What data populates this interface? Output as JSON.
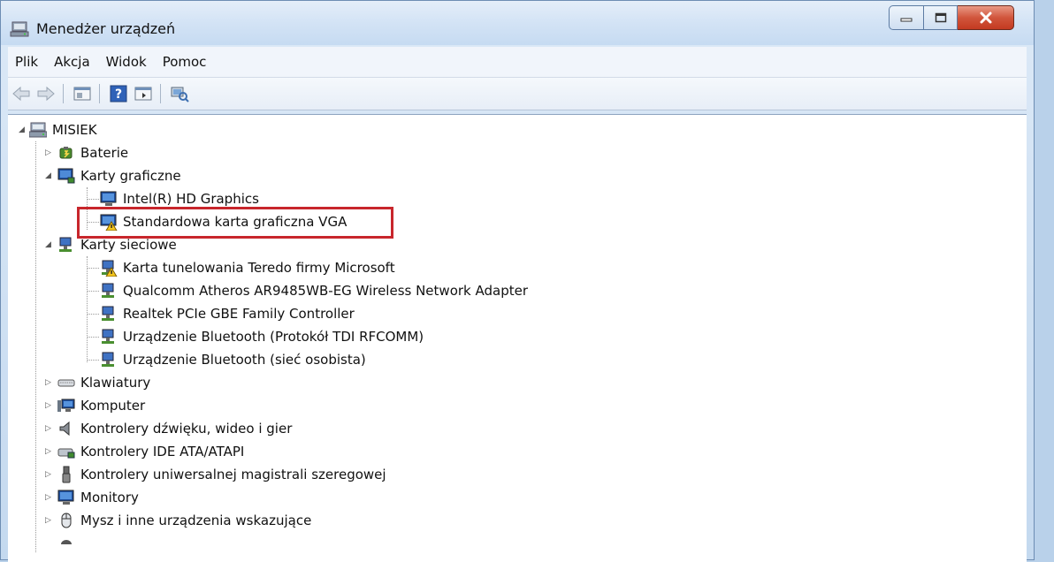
{
  "window": {
    "title": "Menedżer urządzeń"
  },
  "menu": [
    "Plik",
    "Akcja",
    "Widok",
    "Pomoc"
  ],
  "toolbar": {
    "buttons": [
      "back-icon",
      "forward-icon",
      "properties-icon",
      "help-icon",
      "show-hide-icon",
      "scan-hardware-icon"
    ]
  },
  "tree": {
    "root": "MISIEK",
    "categories": [
      {
        "label": "Baterie",
        "expanded": false,
        "icon": "battery-icon"
      },
      {
        "label": "Karty graficzne",
        "expanded": true,
        "icon": "display-adapter-icon",
        "children": [
          {
            "label": "Intel(R) HD Graphics",
            "icon": "monitor-icon",
            "warning": false
          },
          {
            "label": "Standardowa karta graficzna VGA",
            "icon": "monitor-icon",
            "warning": true
          }
        ]
      },
      {
        "label": "Karty sieciowe",
        "expanded": true,
        "icon": "network-adapter-icon",
        "children": [
          {
            "label": "Karta tunelowania Teredo firmy Microsoft",
            "icon": "network-icon",
            "warning": true
          },
          {
            "label": "Qualcomm Atheros AR9485WB-EG Wireless Network Adapter",
            "icon": "network-icon",
            "warning": false
          },
          {
            "label": "Realtek PCIe GBE Family Controller",
            "icon": "network-icon",
            "warning": false
          },
          {
            "label": "Urządzenie Bluetooth (Protokół TDI RFCOMM)",
            "icon": "network-icon",
            "warning": false
          },
          {
            "label": "Urządzenie Bluetooth (sieć osobista)",
            "icon": "network-icon",
            "warning": false
          }
        ]
      },
      {
        "label": "Klawiatury",
        "expanded": false,
        "icon": "keyboard-icon"
      },
      {
        "label": "Komputer",
        "expanded": false,
        "icon": "computer-icon"
      },
      {
        "label": "Kontrolery dźwięku, wideo i gier",
        "expanded": false,
        "icon": "speaker-icon"
      },
      {
        "label": "Kontrolery IDE ATA/ATAPI",
        "expanded": false,
        "icon": "ide-controller-icon"
      },
      {
        "label": "Kontrolery uniwersalnej magistrali szeregowej",
        "expanded": false,
        "icon": "usb-icon"
      },
      {
        "label": "Monitory",
        "expanded": false,
        "icon": "monitor-icon"
      },
      {
        "label": "Mysz i inne urządzenia wskazujące",
        "expanded": false,
        "icon": "mouse-icon"
      }
    ]
  },
  "colors": {
    "highlight_box": "#c8262c",
    "close_button": "#c9442b"
  }
}
